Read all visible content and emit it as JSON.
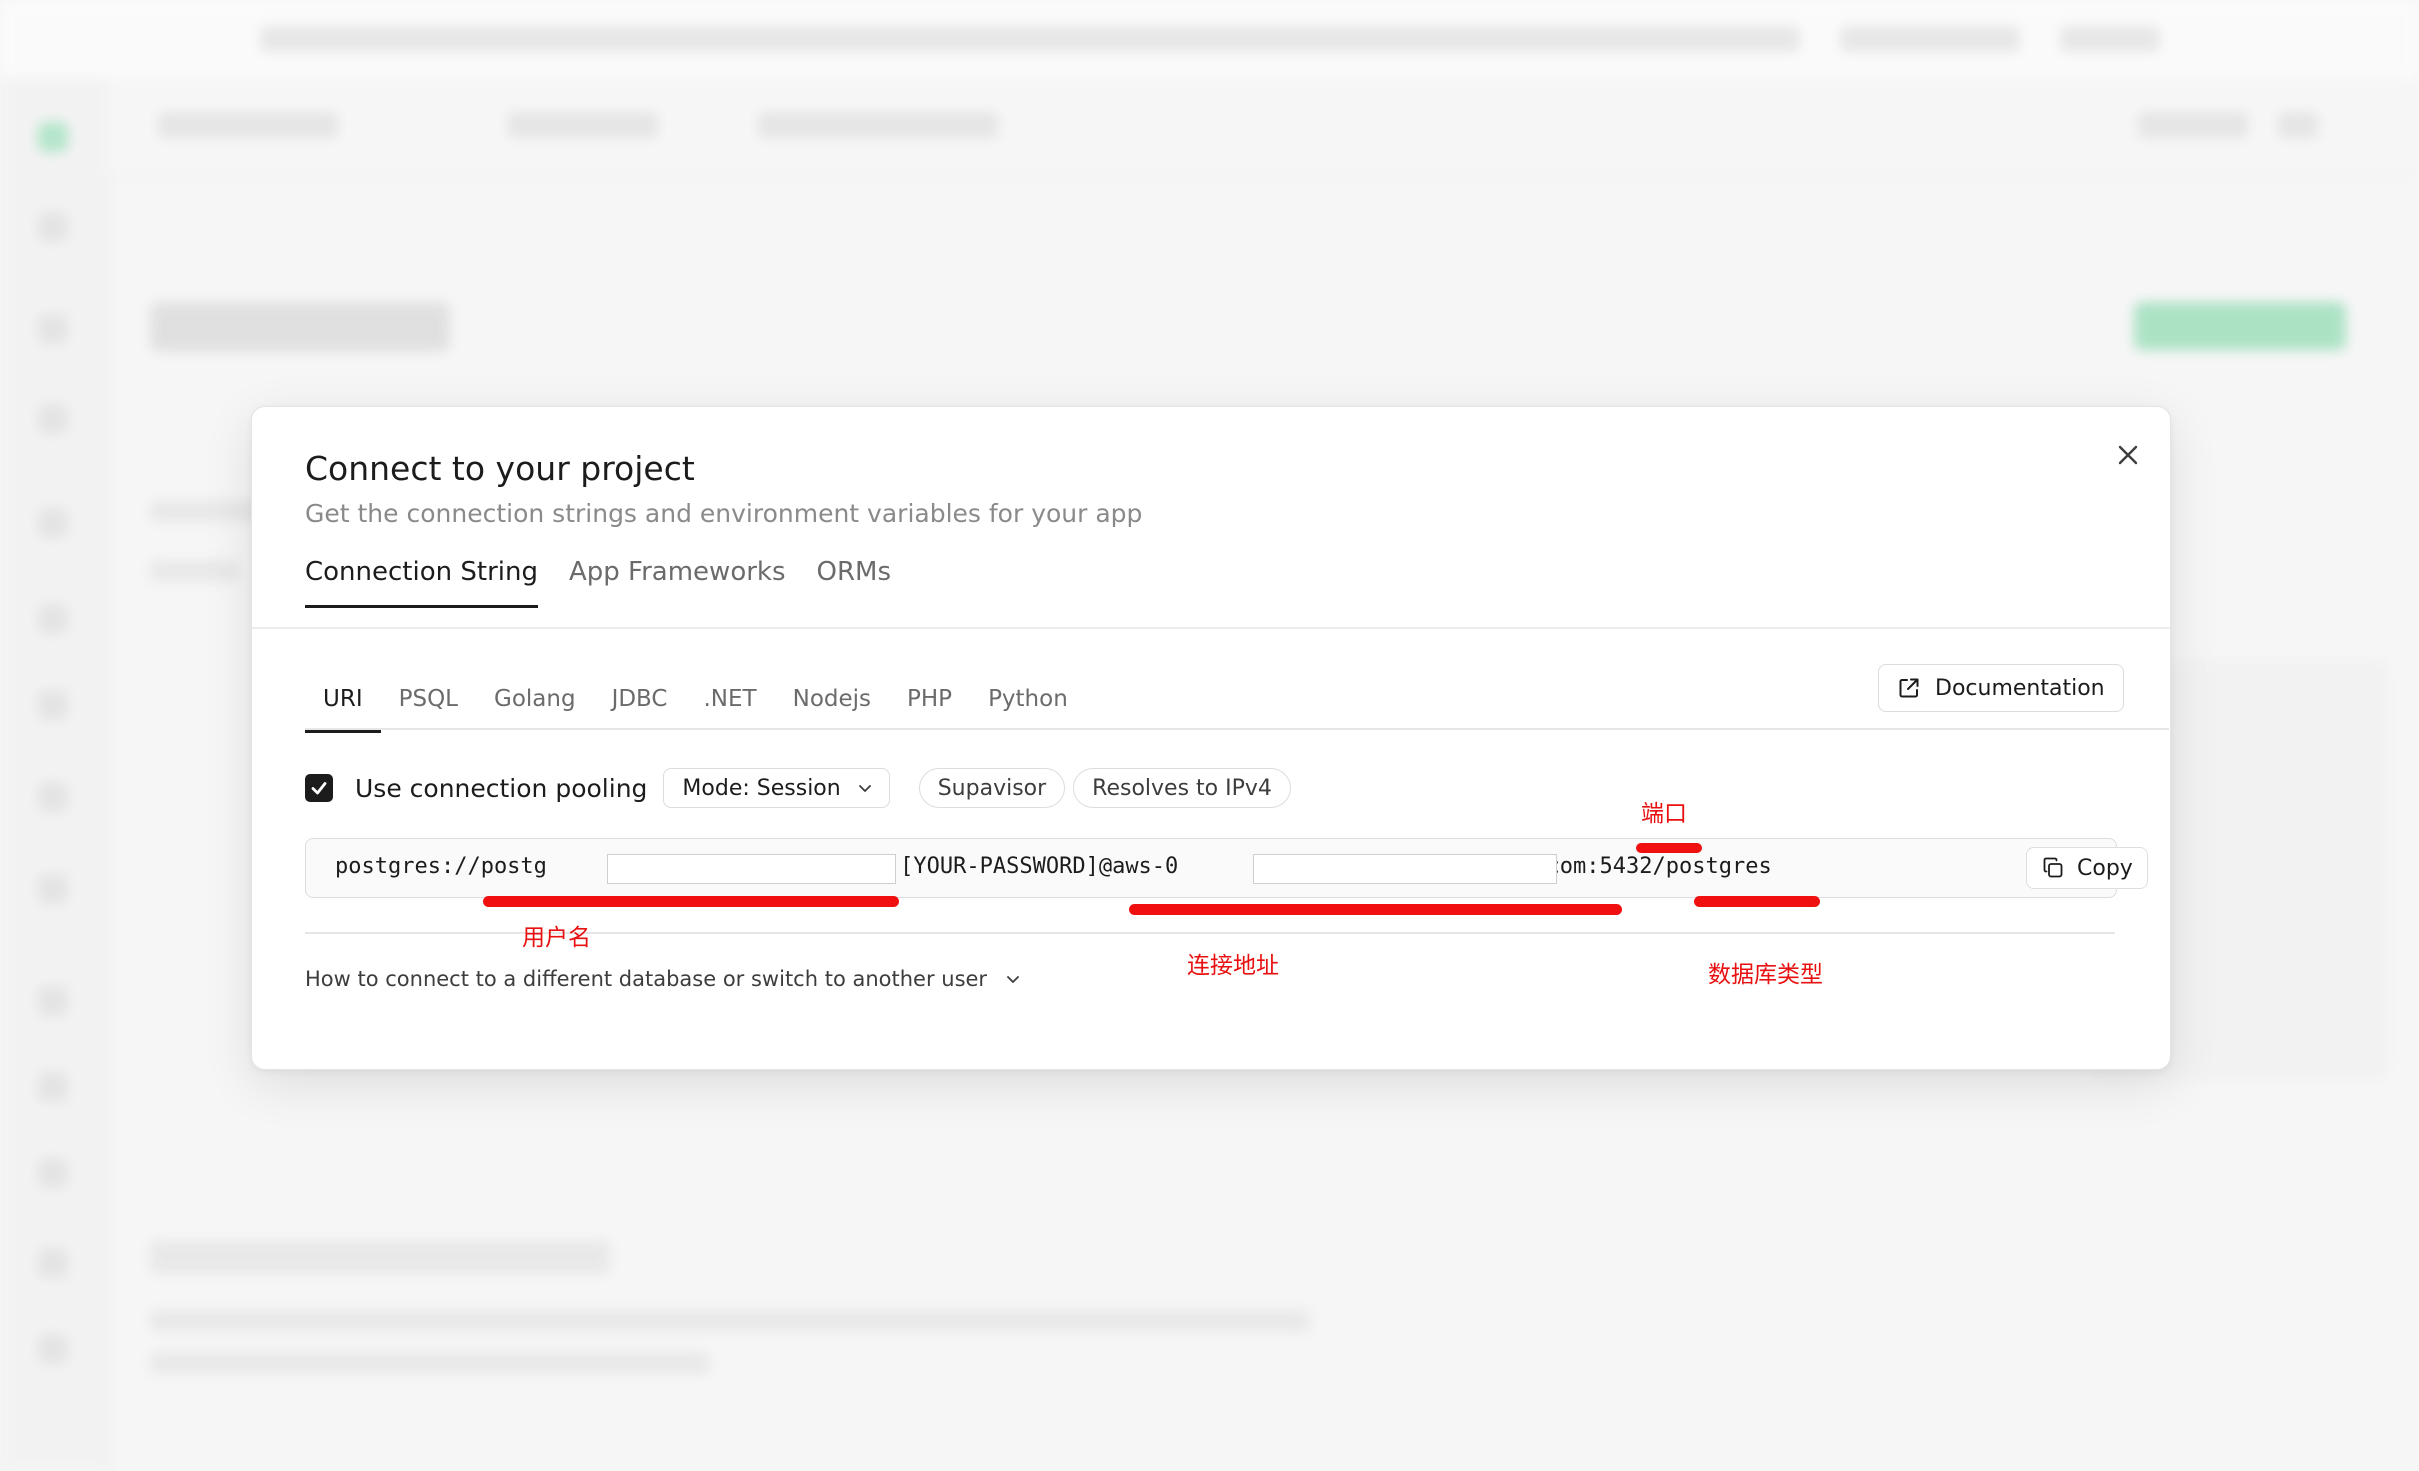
{
  "modal": {
    "title": "Connect to your project",
    "subtitle": "Get the connection strings and environment variables for your app",
    "close_icon": "close-icon"
  },
  "main_tabs": [
    {
      "label": "Connection String",
      "active": true
    },
    {
      "label": "App Frameworks",
      "active": false
    },
    {
      "label": "ORMs",
      "active": false
    }
  ],
  "sub_tabs": [
    {
      "label": "URI",
      "active": true
    },
    {
      "label": "PSQL",
      "active": false
    },
    {
      "label": "Golang",
      "active": false
    },
    {
      "label": "JDBC",
      "active": false
    },
    {
      "label": ".NET",
      "active": false
    },
    {
      "label": "Nodejs",
      "active": false
    },
    {
      "label": "PHP",
      "active": false
    },
    {
      "label": "Python",
      "active": false
    }
  ],
  "documentation": {
    "label": "Documentation",
    "icon": "external-link-icon"
  },
  "pooling": {
    "checked": true,
    "label": "Use connection pooling",
    "mode_label": "Mode: Session",
    "badges": [
      "Supavisor",
      "Resolves to IPv4"
    ]
  },
  "uri": {
    "part1": "postgres://postg",
    "part2": "qnwz:[YOUR-PASSWORD]@aws-0",
    "part3": "base.com:5432/postgres",
    "copy_label": "Copy"
  },
  "help_link": "How to connect to a different database or switch to another user",
  "annotations": {
    "port": "端口",
    "username": "用户名",
    "host": "连接地址",
    "database": "数据库类型",
    "color": "#e81010"
  },
  "colors": {
    "accent": "#1c1c1c",
    "background": "#f6f6f6",
    "annotation": "#f01010",
    "brand_green": "#3ecf8e"
  }
}
